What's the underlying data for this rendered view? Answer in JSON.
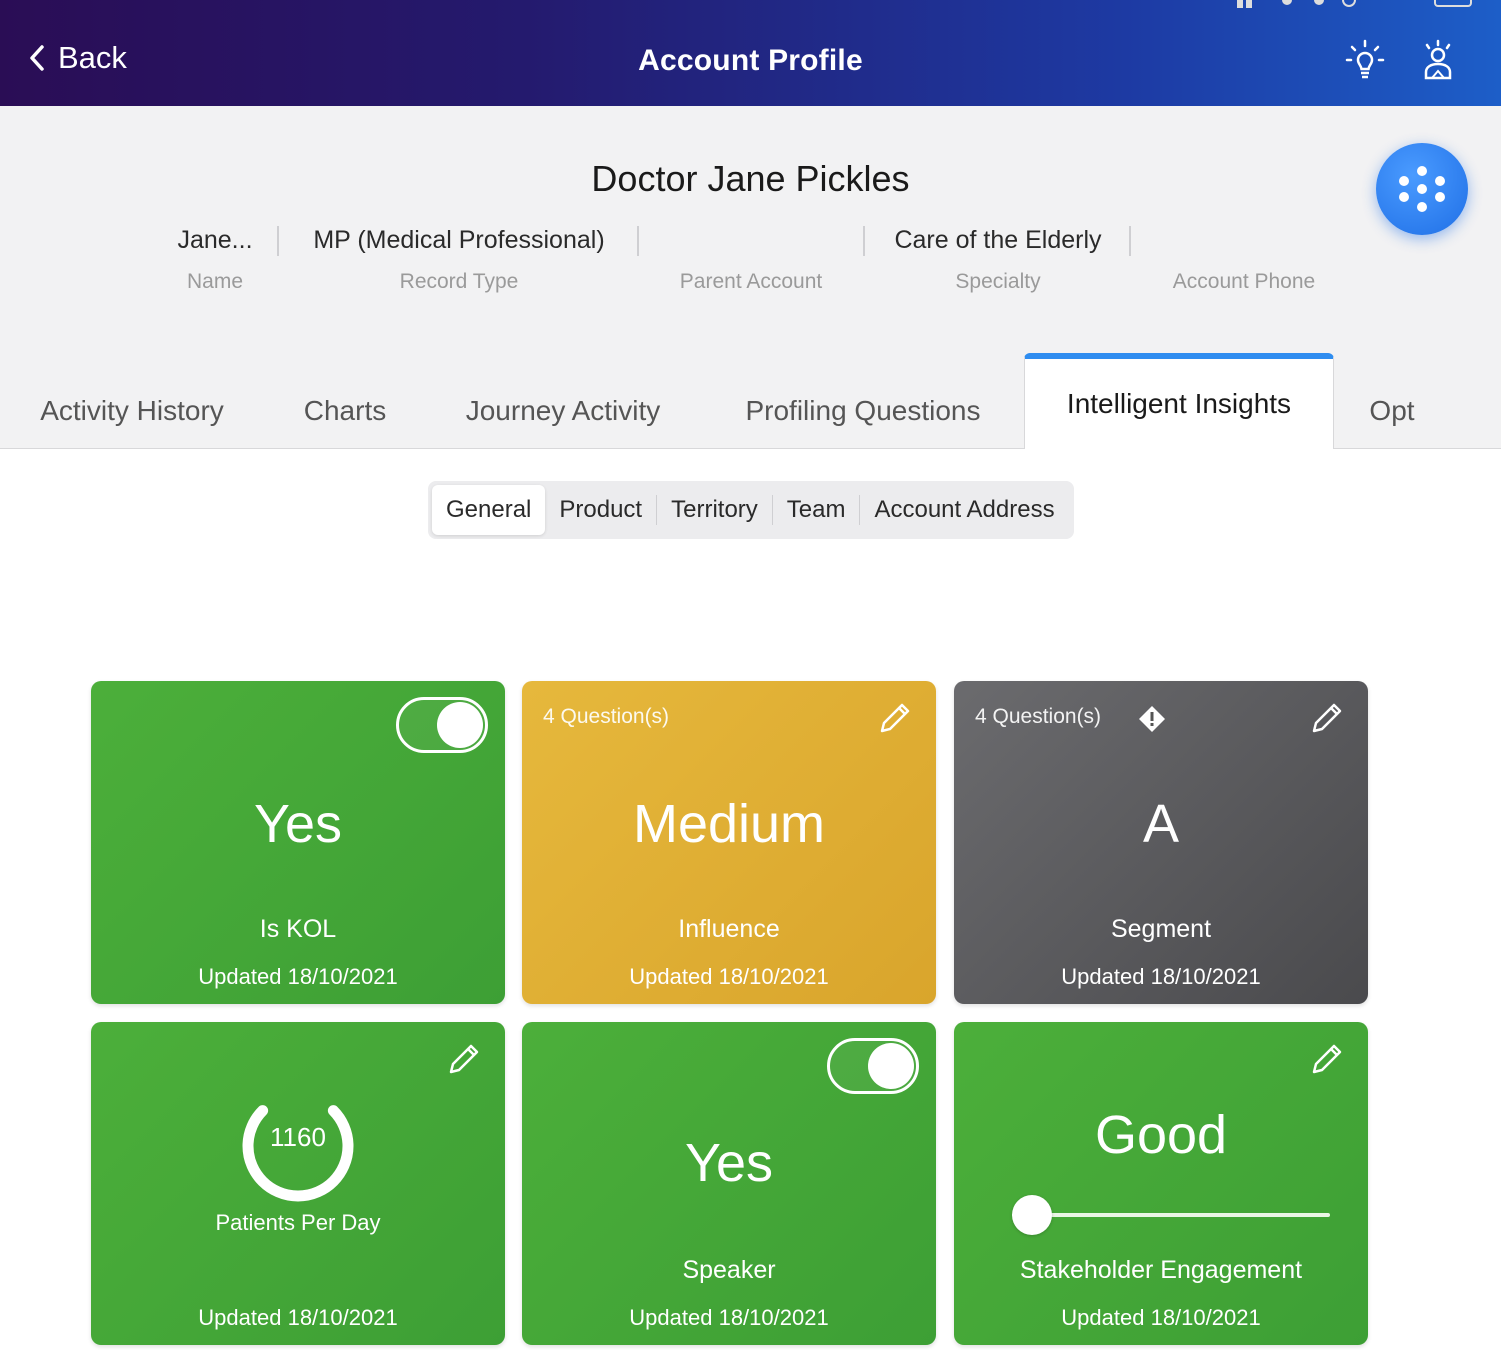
{
  "header": {
    "back_label": "Back",
    "title": "Account Profile"
  },
  "profile": {
    "name": "Doctor Jane Pickles",
    "fields": [
      {
        "value": "Jane...",
        "label": "Name"
      },
      {
        "value": "MP (Medical Professional)",
        "label": "Record Type"
      },
      {
        "value": "",
        "label": "Parent Account"
      },
      {
        "value": "Care of the Elderly",
        "label": "Specialty"
      },
      {
        "value": "",
        "label": "Account Phone"
      }
    ]
  },
  "tabs": [
    {
      "label": "Activity History"
    },
    {
      "label": "Charts"
    },
    {
      "label": "Journey Activity"
    },
    {
      "label": "Profiling Questions"
    },
    {
      "label": "Intelligent Insights",
      "active": true
    },
    {
      "label": "Opt"
    }
  ],
  "subtabs": [
    {
      "label": "General",
      "active": true
    },
    {
      "label": "Product"
    },
    {
      "label": "Territory"
    },
    {
      "label": "Team"
    },
    {
      "label": "Account Address"
    }
  ],
  "cards": [
    {
      "value": "Yes",
      "label": "Is KOL",
      "updated": "Updated 18/10/2021",
      "color": "#45a737",
      "toggle_on": true
    },
    {
      "questions": "4 Question(s)",
      "value": "Medium",
      "label": "Influence",
      "updated": "Updated 18/10/2021",
      "color": "#dfae33"
    },
    {
      "questions": "4 Question(s)",
      "value": "A",
      "label": "Segment",
      "updated": "Updated 18/10/2021",
      "color": "#5a5a5d"
    },
    {
      "value": "1160",
      "label": "Patients Per Day",
      "updated": "Updated 18/10/2021",
      "color": "#45a737",
      "gauge_fraction": 0.75
    },
    {
      "value": "Yes",
      "label": "Speaker",
      "updated": "Updated 18/10/2021",
      "color": "#45a737",
      "toggle_on": true
    },
    {
      "value": "Good",
      "label": "Stakeholder Engagement",
      "updated": "Updated 18/10/2021",
      "color": "#45a737",
      "slider_fraction": 0.0
    }
  ],
  "colors": {
    "accent": "#2f8df0",
    "header_start": "#2a0d55",
    "header_end": "#1d5ec8"
  }
}
